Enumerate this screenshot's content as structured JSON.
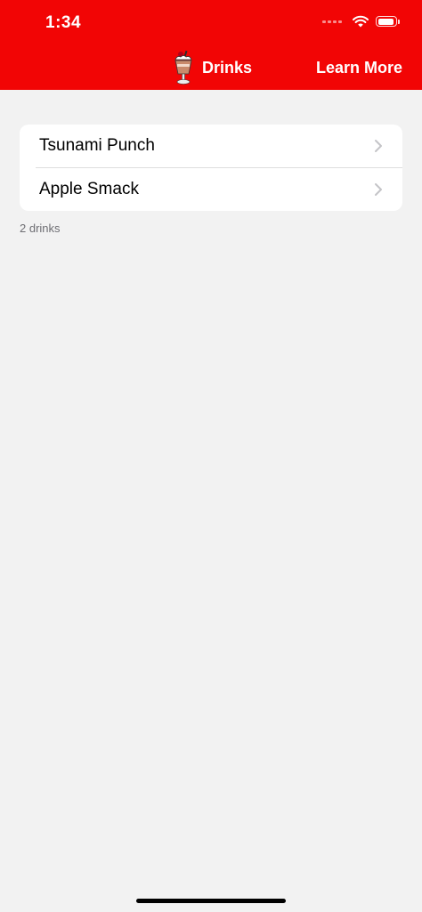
{
  "status_bar": {
    "time": "1:34"
  },
  "nav": {
    "title": "Drinks",
    "action_label": "Learn More"
  },
  "drinks": {
    "items": [
      {
        "label": "Tsunami Punch"
      },
      {
        "label": "Apple Smack"
      }
    ],
    "count_text": "2 drinks"
  },
  "colors": {
    "header_bg": "#f20505",
    "page_bg": "#f2f2f2",
    "card_bg": "#ffffff",
    "chevron": "#c4c4c7"
  },
  "icons": {
    "nav_logo": "milkshake-icon",
    "row_disclosure": "chevron-right-icon",
    "status": [
      "cellular-signal-icon",
      "wifi-icon",
      "battery-icon"
    ]
  }
}
